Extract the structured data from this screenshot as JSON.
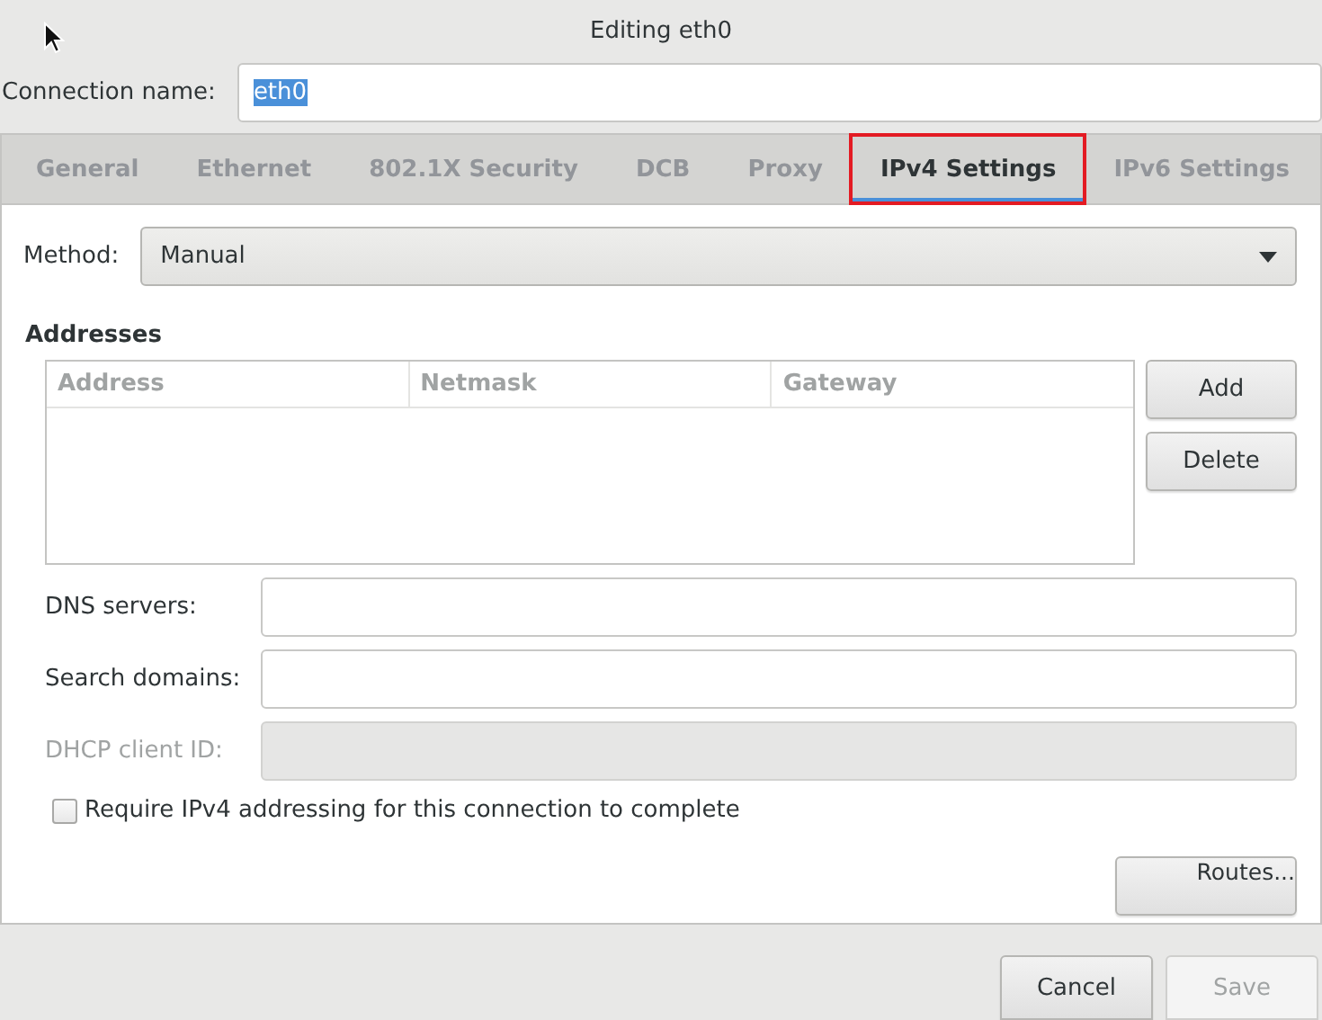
{
  "window": {
    "title": "Editing eth0"
  },
  "connection_name": {
    "label": "Connection name:",
    "value": "eth0",
    "text_selected": true
  },
  "tabs": [
    {
      "label": "General",
      "selected": false,
      "highlighted": false
    },
    {
      "label": "Ethernet",
      "selected": false,
      "highlighted": false
    },
    {
      "label": "802.1X Security",
      "selected": false,
      "highlighted": false
    },
    {
      "label": "DCB",
      "selected": false,
      "highlighted": false
    },
    {
      "label": "Proxy",
      "selected": false,
      "highlighted": false
    },
    {
      "label": "IPv4 Settings",
      "selected": true,
      "highlighted": true
    },
    {
      "label": "IPv6 Settings",
      "selected": false,
      "highlighted": false
    }
  ],
  "method": {
    "label": "Method:",
    "value": "Manual"
  },
  "addresses": {
    "heading": "Addresses",
    "columns": [
      "Address",
      "Netmask",
      "Gateway"
    ],
    "buttons": [
      {
        "label": "Add",
        "disabled": false
      },
      {
        "label": "Delete",
        "disabled": false
      }
    ]
  },
  "fields": [
    {
      "label": "DNS servers:",
      "disabled": false
    },
    {
      "label": "Search domains:",
      "disabled": false
    },
    {
      "label": "DHCP client ID:",
      "disabled": true
    }
  ],
  "require_checkbox": {
    "label": "Require IPv4 addressing for this connection to complete",
    "checked": false
  },
  "routes_button": {
    "label": "Routes...",
    "disabled": false
  },
  "footer_buttons": [
    {
      "label": "Cancel",
      "disabled": false
    },
    {
      "label": "Save",
      "disabled": true
    }
  ]
}
